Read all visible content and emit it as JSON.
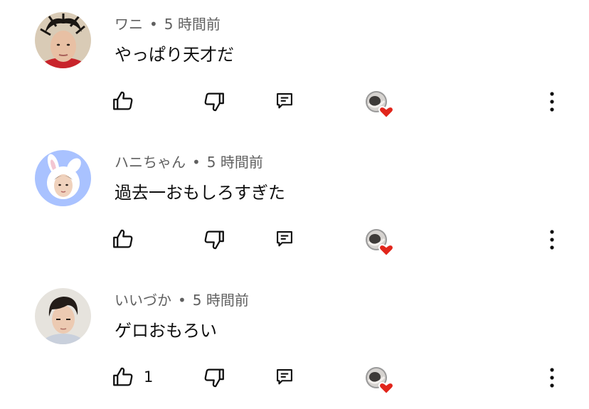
{
  "comments": [
    {
      "author": "ワニ",
      "separator": "•",
      "time": "5 時間前",
      "text": "やっぱり天才だ",
      "like_count": "",
      "avatar_icon": "avatar-woman-messy-hair-icon"
    },
    {
      "author": "ハニちゃん",
      "separator": "•",
      "time": "5 時間前",
      "text": "過去一おもしろすぎた",
      "like_count": "",
      "avatar_icon": "avatar-bunny-hood-icon"
    },
    {
      "author": "いいづか",
      "separator": "•",
      "time": "5 時間前",
      "text": "ゲロおもろい",
      "like_count": "1",
      "avatar_icon": "avatar-young-man-icon"
    }
  ],
  "icons": {
    "like": "thumb-up-icon",
    "dislike": "thumb-down-icon",
    "reply": "reply-icon",
    "creator_heart": "creator-heart-icon",
    "more": "more-vertical-icon"
  },
  "colors": {
    "author_text": "#606060",
    "body_text": "#0f0f0f",
    "heart": "#e1251b",
    "bunny_bg": "#a9c2ff"
  }
}
